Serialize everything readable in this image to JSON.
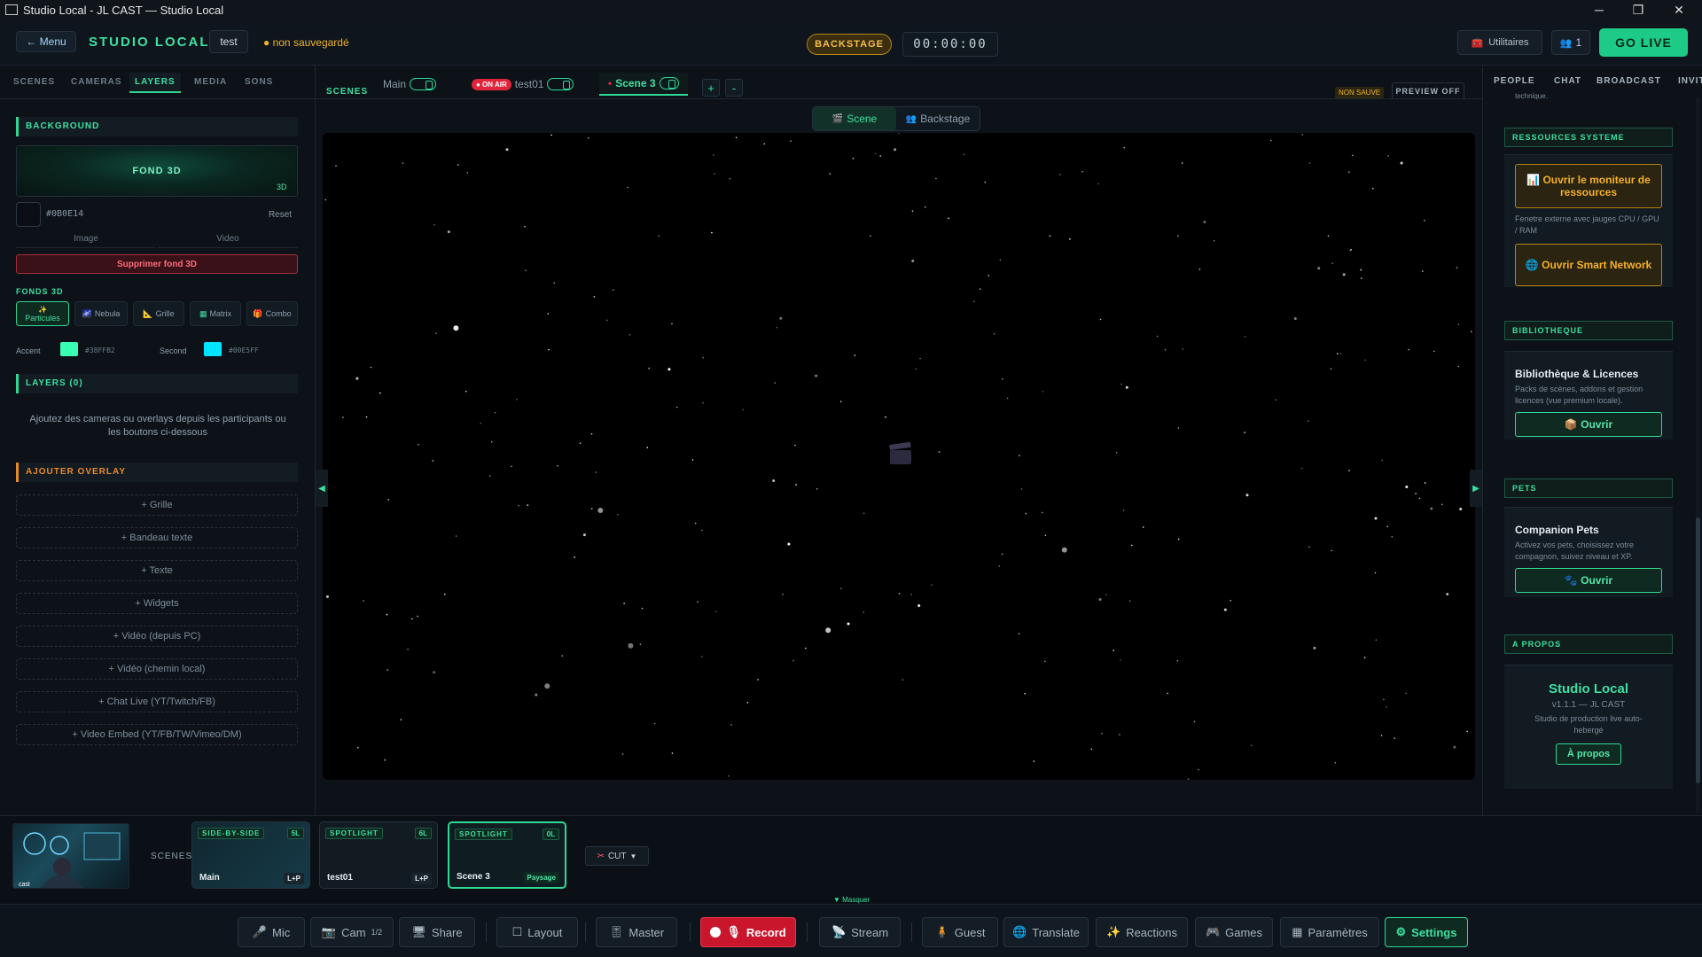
{
  "window": {
    "title": "Studio Local - JL CAST — Studio Local"
  },
  "header": {
    "menu_label": "← Menu",
    "brand": "STUDIO LOCAL",
    "project_name": "test",
    "unsaved": "● non sauvegardé",
    "backstage_label": "BACKSTAGE",
    "timer": "00:00:00",
    "utilities_label": "Utilitaires",
    "people_count": "1",
    "go_live_label": "GO LIVE"
  },
  "left_panel": {
    "tabs": [
      "SCENES",
      "CAMERAS",
      "LAYERS",
      "MEDIA",
      "SONS"
    ],
    "active_tab": "LAYERS",
    "background": {
      "title": "BACKGROUND",
      "preview_label": "FOND 3D",
      "preview_badge": "3D",
      "color_hex": "#0B0E14",
      "reset_label": "Reset",
      "image_label": "Image",
      "video_label": "Video",
      "delete_3d_label": "Supprimer fond 3D"
    },
    "fonds3d": {
      "title": "FONDS 3D",
      "options": [
        {
          "icon": "✨",
          "label": "Particules",
          "active": true
        },
        {
          "icon": "🌌",
          "label": "Nebula"
        },
        {
          "icon": "📐",
          "label": "Grille"
        },
        {
          "icon": "▦",
          "label": "Matrix"
        },
        {
          "icon": "🎁",
          "label": "Combo"
        }
      ],
      "accent_label": "Accent",
      "accent_hex": "#38FFB2",
      "accent_color": "#38ffb2",
      "second_label": "Second",
      "second_hex": "#00E5FF",
      "second_color": "#00e5ff"
    },
    "layers": {
      "title": "LAYERS (0)",
      "hint": "Ajoutez des cameras ou overlays depuis les participants ou les boutons ci-dessous"
    },
    "overlay": {
      "title": "AJOUTER OVERLAY",
      "buttons": [
        "+ Grille",
        "+ Bandeau texte",
        "+ Texte",
        "+ Widgets",
        "+ Vidéo (depuis PC)",
        "+ Vidéo (chemin local)",
        "+ Chat Live (YT/Twitch/FB)",
        "+ Video Embed (YT/FB/TW/Vimeo/DM)"
      ]
    }
  },
  "scene_tabs": {
    "label": "SCENES",
    "tabs": [
      {
        "name": "Main"
      },
      {
        "badge": "● ON AIR",
        "name": "test01"
      },
      {
        "name": "Scene 3",
        "prefix": "•"
      }
    ],
    "add_label": "+",
    "remove_label": "-",
    "non_sauve": "NON SAUVE",
    "preview_off": "PREVIEW OFF"
  },
  "stage": {
    "view_scene": "Scene",
    "view_backstage": "Backstage",
    "left_arrow": "◀",
    "right_arrow": "▶"
  },
  "right_panel": {
    "tabs": [
      "PEOPLE",
      "CHAT",
      "BROADCAST",
      "INVITE"
    ],
    "truncated_text": "technique.",
    "ressources": {
      "title": "RESSOURCES SYSTEME",
      "monitor_btn": "📊 Ouvrir le moniteur de ressources",
      "monitor_desc": "Fenetre externe avec jauges CPU / GPU / RAM",
      "network_btn": "🌐 Ouvrir Smart Network"
    },
    "bibliotheque": {
      "title": "BIBLIOTHEQUE",
      "card_title": "Bibliothèque & Licences",
      "card_desc": "Packs de scènes, addons et gestion licences (vue premium locale).",
      "open_btn": "📦 Ouvrir"
    },
    "pets": {
      "title": "PETS",
      "card_title": "Companion Pets",
      "card_desc": "Activez vos pets, choisissez votre compagnon, suivez niveau et XP.",
      "open_btn": "🐾 Ouvrir"
    },
    "apropos": {
      "title": "A PROPOS",
      "app_name": "Studio Local",
      "version": "v1.1.1 — JL CAST",
      "desc": "Studio de production live auto-hebergé",
      "btn": "À propos"
    }
  },
  "strip": {
    "scenes_label": "SCENES",
    "thumb_caption": "cast",
    "cards": [
      {
        "type": "SIDE-BY-SIDE",
        "count": "5L",
        "name": "Main",
        "layout": "L+P"
      },
      {
        "type": "SPOTLIGHT",
        "count": "6L",
        "name": "test01",
        "layout": "L+P"
      },
      {
        "type": "SPOTLIGHT",
        "count": "0L",
        "name": "Scene 3",
        "layout": "Paysage",
        "active": true
      }
    ],
    "cut_label": "CUT",
    "cut_icon": "✂",
    "masquer": "▼ Masquer"
  },
  "toolbar": {
    "mic": "Mic",
    "cam": "Cam",
    "cam_count": "1/2",
    "share": "Share",
    "layout": "Layout",
    "master": "Master",
    "record": "Record",
    "stream": "Stream",
    "guest": "Guest",
    "translate": "Translate",
    "reactions": "Reactions",
    "games": "Games",
    "parametres": "Paramètres",
    "settings": "Settings"
  }
}
